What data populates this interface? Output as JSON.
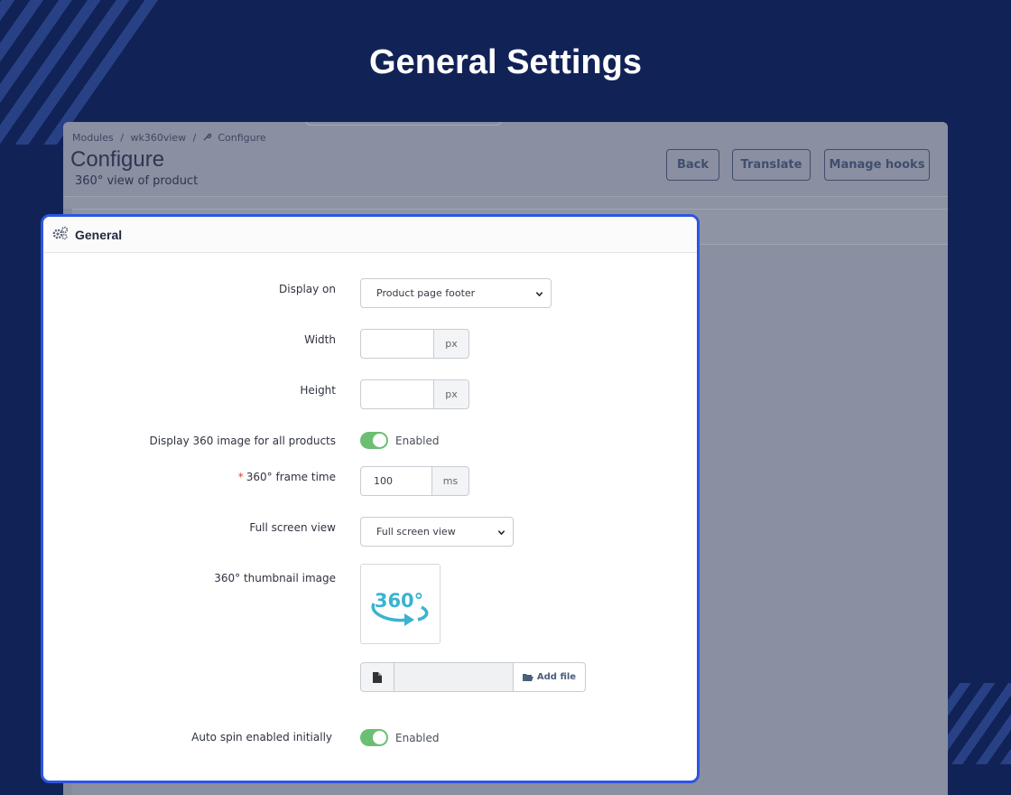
{
  "page_title": "General Settings",
  "background_window": {
    "breadcrumb": [
      "Modules",
      "/",
      "wk360view",
      "/",
      "Configure"
    ],
    "heading": "Configure",
    "subheading": "360° view of product",
    "buttons": {
      "back": "Back",
      "translate": "Translate",
      "manage_hooks": "Manage hooks"
    }
  },
  "panel": {
    "title": "General",
    "fields": {
      "display_on": {
        "label": "Display on",
        "value": "Product page footer"
      },
      "width": {
        "label": "Width",
        "value": "",
        "unit": "px"
      },
      "height": {
        "label": "Height",
        "value": "",
        "unit": "px"
      },
      "display_all": {
        "label": "Display 360 image for all products",
        "state": "Enabled"
      },
      "frame_time": {
        "required_mark": "*",
        "label": "360° frame time",
        "value": "100",
        "unit": "ms"
      },
      "full_screen": {
        "label": "Full screen view",
        "value": "Full screen view"
      },
      "thumbnail": {
        "label": "360° thumbnail image",
        "image_text": "360°",
        "add_file": "Add file"
      },
      "auto_spin": {
        "label": "Auto spin enabled initially",
        "state": "Enabled"
      }
    }
  },
  "colors": {
    "background": "#112257",
    "accent_border": "#2d55e3",
    "toggle_on": "#6cbf72",
    "icon_360": "#3bb3d0"
  }
}
